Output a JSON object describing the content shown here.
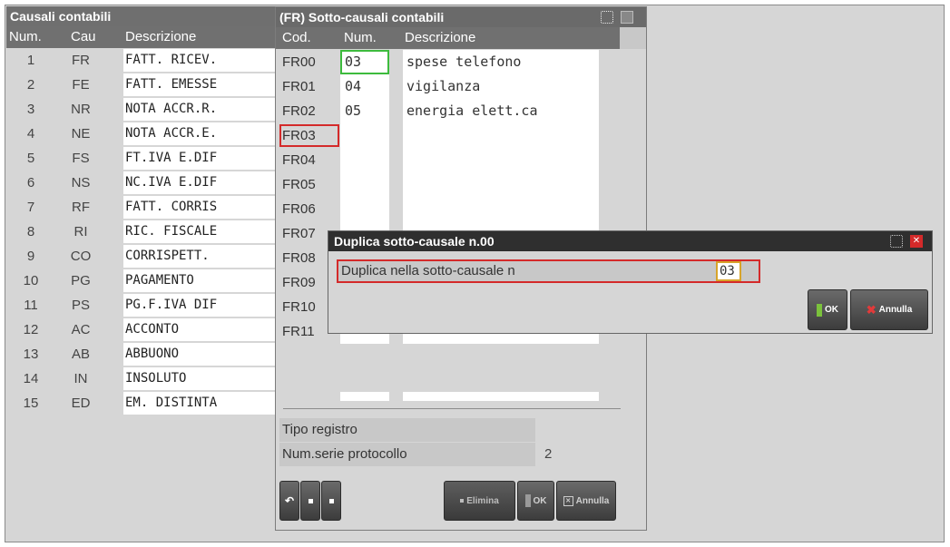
{
  "left_panel": {
    "title": "Causali contabili",
    "columns": {
      "num": "Num.",
      "cau": "Cau",
      "desc": "Descrizione"
    },
    "rows": [
      {
        "num": "1",
        "cau": "FR",
        "desc": "FATT. RICEV."
      },
      {
        "num": "2",
        "cau": "FE",
        "desc": "FATT. EMESSE"
      },
      {
        "num": "3",
        "cau": "NR",
        "desc": "NOTA ACCR.R."
      },
      {
        "num": "4",
        "cau": "NE",
        "desc": "NOTA ACCR.E."
      },
      {
        "num": "5",
        "cau": "FS",
        "desc": "FT.IVA E.DIF"
      },
      {
        "num": "6",
        "cau": "NS",
        "desc": "NC.IVA E.DIF"
      },
      {
        "num": "7",
        "cau": "RF",
        "desc": "FATT. CORRIS"
      },
      {
        "num": "8",
        "cau": "RI",
        "desc": "RIC. FISCALE"
      },
      {
        "num": "9",
        "cau": "CO",
        "desc": "CORRISPETT."
      },
      {
        "num": "10",
        "cau": "PG",
        "desc": "PAGAMENTO"
      },
      {
        "num": "11",
        "cau": "PS",
        "desc": "PG.F.IVA DIF"
      },
      {
        "num": "12",
        "cau": "AC",
        "desc": "ACCONTO"
      },
      {
        "num": "13",
        "cau": "AB",
        "desc": "ABBUONO"
      },
      {
        "num": "14",
        "cau": "IN",
        "desc": "INSOLUTO"
      },
      {
        "num": "15",
        "cau": "ED",
        "desc": "EM. DISTINTA"
      }
    ]
  },
  "sub_panel": {
    "title": "(FR) Sotto-causali contabili",
    "columns": {
      "cod": "Cod.",
      "num": "Num.",
      "desc": "Descrizione"
    },
    "rows": [
      {
        "cod": "FR00",
        "num": "03",
        "desc": "spese telefono"
      },
      {
        "cod": "FR01",
        "num": "04",
        "desc": "vigilanza"
      },
      {
        "cod": "FR02",
        "num": "05",
        "desc": "energia elett.ca"
      },
      {
        "cod": "FR03",
        "num": "",
        "desc": ""
      },
      {
        "cod": "FR04",
        "num": "",
        "desc": ""
      },
      {
        "cod": "FR05",
        "num": "",
        "desc": ""
      },
      {
        "cod": "FR06",
        "num": "",
        "desc": ""
      },
      {
        "cod": "FR07",
        "num": "",
        "desc": ""
      },
      {
        "cod": "FR08",
        "num": "",
        "desc": ""
      },
      {
        "cod": "FR09",
        "num": "",
        "desc": ""
      },
      {
        "cod": "FR10",
        "num": "",
        "desc": ""
      },
      {
        "cod": "FR11",
        "num": "",
        "desc": ""
      }
    ],
    "tipo_registro_label": "Tipo registro",
    "tipo_registro_value": "",
    "num_serie_label": "Num.serie protocollo",
    "num_serie_value": "2",
    "buttons": {
      "elimina": "Elimina",
      "ok": "OK",
      "annulla": "Annulla"
    }
  },
  "dialog": {
    "title": "Duplica sotto-causale n.00",
    "field_label": "Duplica nella sotto-causale n",
    "field_value": "03",
    "ok_label": "OK",
    "annulla_label": "Annulla"
  },
  "colors": {
    "title_bar": "#6f6f6f",
    "header": "#707070",
    "panel_bg": "#d6d6d6",
    "highlight_red": "#d42a2a",
    "highlight_green": "#3dbb3d",
    "dialog_title": "#2f2f2f"
  }
}
